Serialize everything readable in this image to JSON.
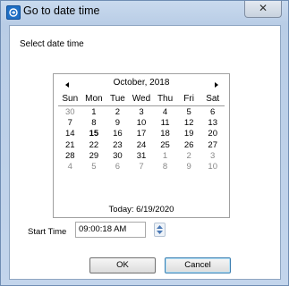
{
  "window": {
    "title": "Go to date time",
    "close_label": "✕"
  },
  "dialog": {
    "subtitle": "Select date time"
  },
  "calendar": {
    "month_label": "October, 2018",
    "days_of_week": [
      "Sun",
      "Mon",
      "Tue",
      "Wed",
      "Thu",
      "Fri",
      "Sat"
    ],
    "weeks": [
      [
        "30",
        "1",
        "2",
        "3",
        "4",
        "5",
        "6"
      ],
      [
        "7",
        "8",
        "9",
        "10",
        "11",
        "12",
        "13"
      ],
      [
        "14",
        "15",
        "16",
        "17",
        "18",
        "19",
        "20"
      ],
      [
        "21",
        "22",
        "23",
        "24",
        "25",
        "26",
        "27"
      ],
      [
        "28",
        "29",
        "30",
        "31",
        "1",
        "2",
        "3"
      ],
      [
        "4",
        "5",
        "6",
        "7",
        "8",
        "9",
        "10"
      ]
    ],
    "selected_day": "15",
    "today_label": "Today: 6/19/2020"
  },
  "time": {
    "label": "Start Time",
    "value": "09:00:18 AM"
  },
  "buttons": {
    "ok": "OK",
    "cancel": "Cancel"
  }
}
